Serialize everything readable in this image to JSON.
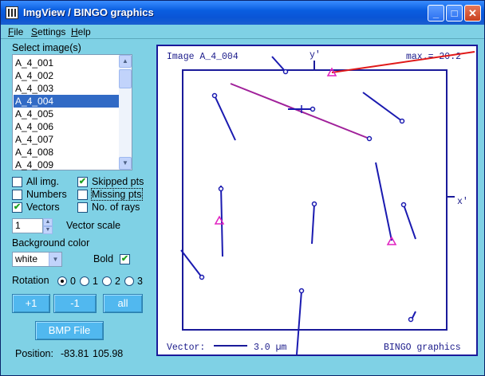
{
  "window": {
    "title": "ImgView / BINGO graphics",
    "buttons": {
      "minimize": "_",
      "maximize": "□",
      "close": "✕"
    }
  },
  "menu": {
    "file": "File",
    "settings": "Settings",
    "help": "Help"
  },
  "left_panel": {
    "select_label": "Select image(s)",
    "images": [
      "A_4_001",
      "A_4_002",
      "A_4_003",
      "A_4_004",
      "A_4_005",
      "A_4_006",
      "A_4_007",
      "A_4_008",
      "A_4_009"
    ],
    "selected_index": 3,
    "options": {
      "all_img": {
        "label": "All img.",
        "checked": false
      },
      "skipped_pts": {
        "label": "Skipped pts",
        "checked": true
      },
      "numbers": {
        "label": "Numbers",
        "checked": false
      },
      "missing_pts": {
        "label": "Missing pts",
        "checked": false
      },
      "vectors": {
        "label": "Vectors",
        "checked": true
      },
      "no_of_rays": {
        "label": "No. of rays",
        "checked": false
      }
    },
    "vector_scale": {
      "value": "1",
      "label": "Vector scale"
    },
    "background": {
      "label": "Background color",
      "value": "white"
    },
    "bold": {
      "label": "Bold",
      "checked": true
    },
    "rotation": {
      "label": "Rotation",
      "options": [
        "0",
        "1",
        "2",
        "3"
      ],
      "selected": "0"
    },
    "nav_buttons": {
      "plus1": "+1",
      "minus1": "-1",
      "all": "all"
    },
    "bmp_button": "BMP File",
    "position": {
      "label": "Position:",
      "x": "-83.81",
      "y": "105.98"
    }
  },
  "plot": {
    "image_label": "Image A_4_004",
    "max_label": "max.= 20.2",
    "y_axis": "y'",
    "x_axis": "x'",
    "vector_label": "Vector:",
    "scale_label": "3.0 µm",
    "brand": "BINGO graphics",
    "colors": {
      "frame": "#1a1a9a",
      "vector": "#1a1ab0",
      "max": "#e01a1a",
      "long": "#a0209a",
      "skipped": "#e020c0"
    }
  }
}
